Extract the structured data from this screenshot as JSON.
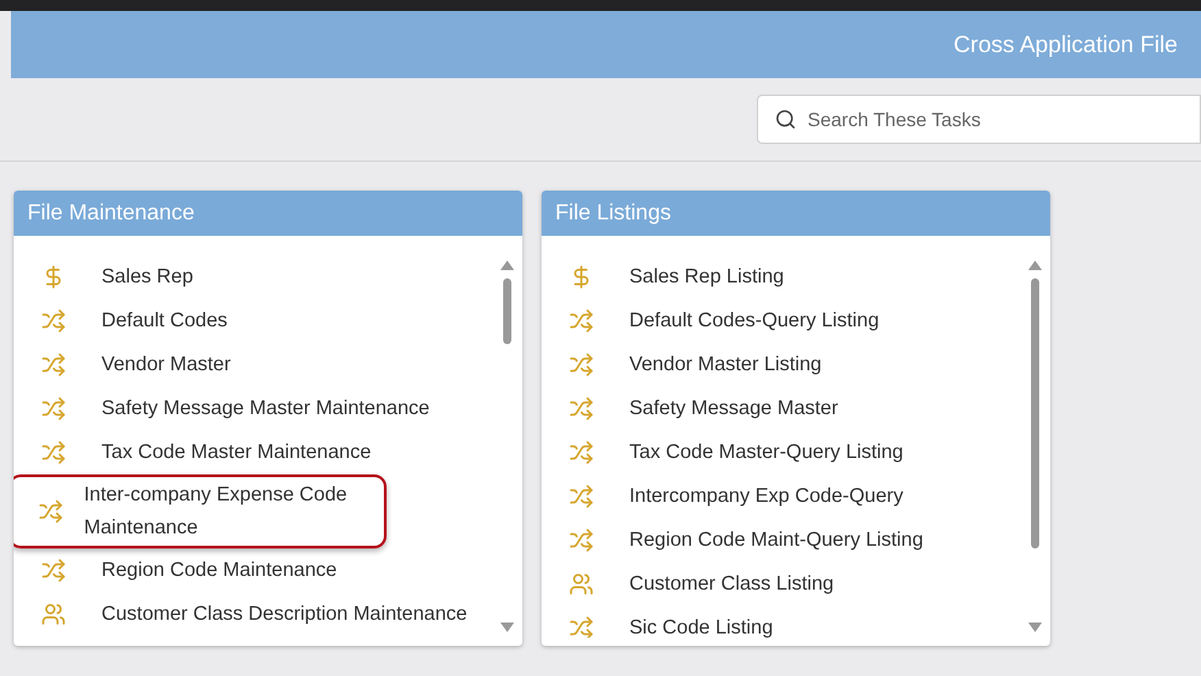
{
  "header": {
    "title": "Cross Application File"
  },
  "search": {
    "placeholder": "Search These Tasks"
  },
  "panels": [
    {
      "title": "File Maintenance",
      "items": [
        {
          "label": "Sales Rep",
          "kind": "dollar",
          "highlighted": false
        },
        {
          "label": "Default Codes",
          "kind": "shuffle",
          "highlighted": false
        },
        {
          "label": "Vendor Master",
          "kind": "shuffle",
          "highlighted": false
        },
        {
          "label": "Safety Message Master Maintenance",
          "kind": "shuffle",
          "highlighted": false
        },
        {
          "label": "Tax Code Master Maintenance",
          "kind": "shuffle",
          "highlighted": false
        },
        {
          "label": "Inter-company Expense Code Maintenance",
          "kind": "shuffle",
          "highlighted": true
        },
        {
          "label": "Region Code Maintenance",
          "kind": "shuffle",
          "highlighted": false
        },
        {
          "label": "Customer Class Description Maintenance",
          "kind": "people",
          "highlighted": false
        }
      ]
    },
    {
      "title": "File Listings",
      "items": [
        {
          "label": "Sales Rep Listing",
          "kind": "dollar",
          "highlighted": false
        },
        {
          "label": "Default Codes-Query Listing",
          "kind": "shuffle",
          "highlighted": false
        },
        {
          "label": "Vendor Master Listing",
          "kind": "shuffle",
          "highlighted": false
        },
        {
          "label": "Safety Message Master",
          "kind": "shuffle",
          "highlighted": false
        },
        {
          "label": "Tax Code Master-Query Listing",
          "kind": "shuffle",
          "highlighted": false
        },
        {
          "label": "Intercompany Exp Code-Query",
          "kind": "shuffle",
          "highlighted": false
        },
        {
          "label": "Region Code Maint-Query Listing",
          "kind": "shuffle",
          "highlighted": false
        },
        {
          "label": "Customer Class Listing",
          "kind": "people",
          "highlighted": false
        },
        {
          "label": "Sic Code Listing",
          "kind": "shuffle",
          "highlighted": false
        }
      ]
    }
  ]
}
